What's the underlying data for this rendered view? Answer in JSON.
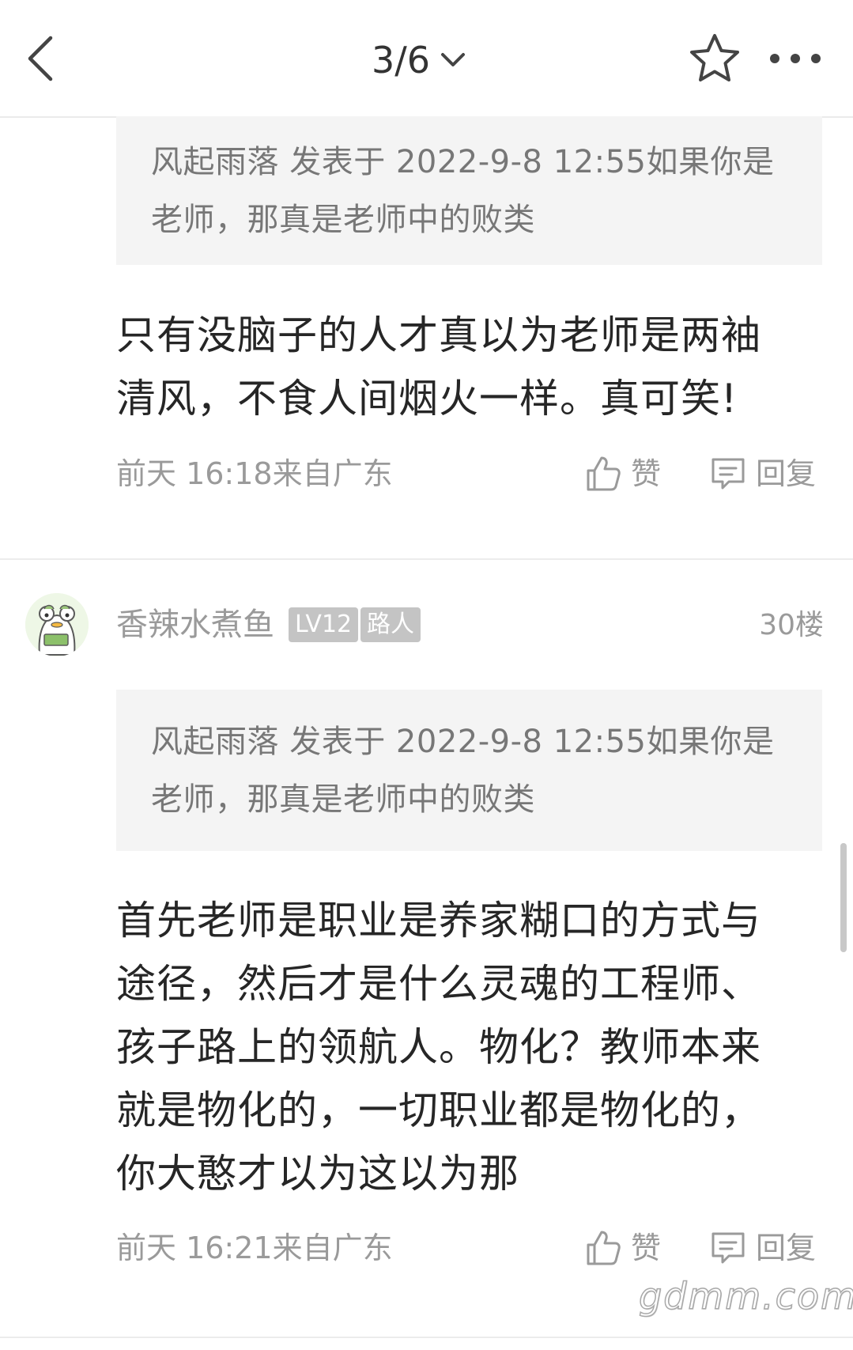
{
  "header": {
    "back_icon": "chevron-left-icon",
    "page_indicator": "3/6",
    "dropdown_icon": "chevron-down-icon",
    "favorite_icon": "star-icon",
    "more_icon": "more-horizontal-icon"
  },
  "comments": [
    {
      "quote": "风起雨落 发表于 2022-9-8 12:55如果你是老师，那真是老师中的败类",
      "body": "只有没脑子的人才真以为老师是两袖清风，不食人间烟火一样。真可笑!",
      "meta": "前天 16:18来自广东",
      "like_label": "赞",
      "reply_label": "回复"
    },
    {
      "username": "香辣水煮鱼",
      "level_badge": "LV12",
      "role_badge": "路人",
      "floor": "30楼",
      "quote": "风起雨落 发表于 2022-9-8 12:55如果你是老师，那真是老师中的败类",
      "body": "首先老师是职业是养家糊口的方式与途径，然后才是什么灵魂的工程师、孩子路上的领航人。物化？教师本来就是物化的，一切职业都是物化的，你大憨才以为这以为那",
      "meta": "前天 16:21来自广东",
      "like_label": "赞",
      "reply_label": "回复"
    }
  ],
  "watermark": "gdmm.com",
  "colors": {
    "quote_bg": "#f4f4f4",
    "meta_text": "#9a9a9a",
    "badge_bg": "#c4c4c4"
  }
}
